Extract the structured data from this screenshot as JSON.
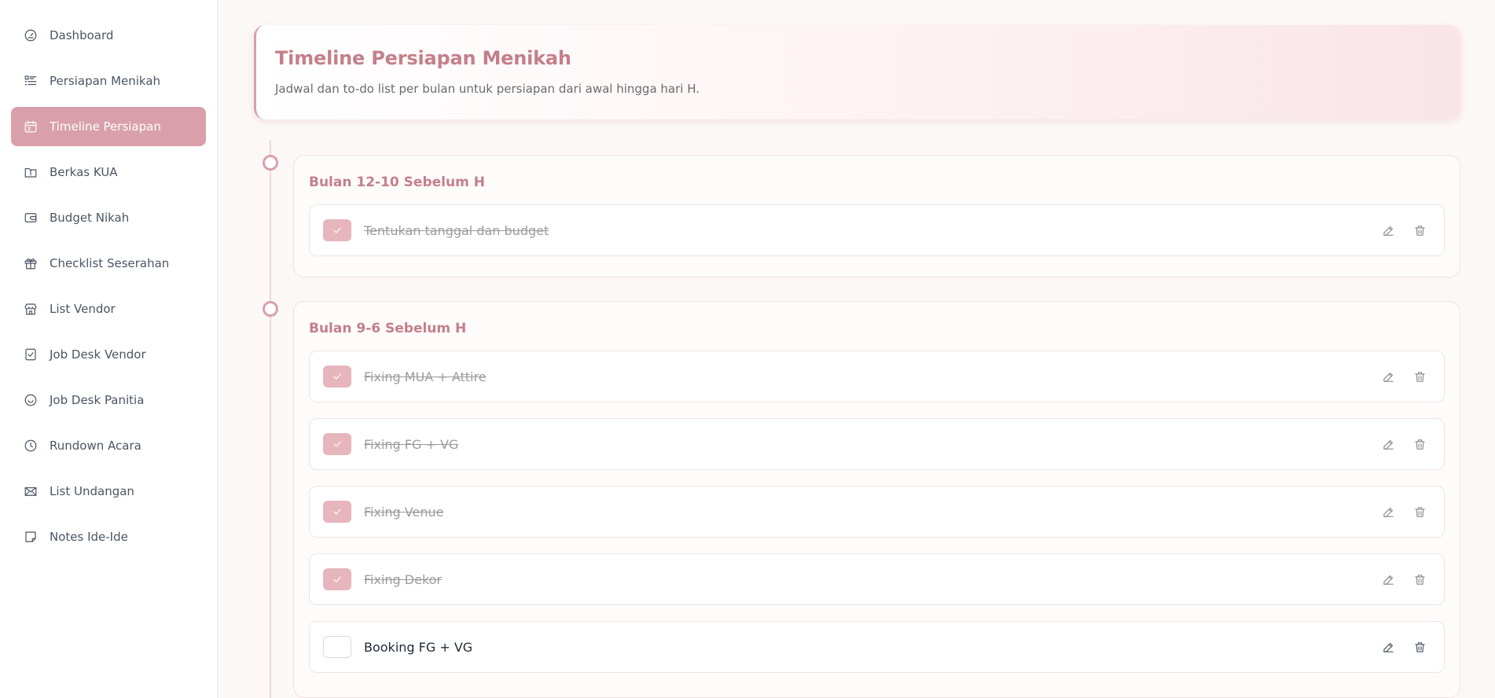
{
  "sidebar": {
    "items": [
      {
        "label": "Dashboard",
        "icon": "gauge-icon"
      },
      {
        "label": "Persiapan Menikah",
        "icon": "list-icon"
      },
      {
        "label": "Timeline Persiapan",
        "icon": "calendar-icon",
        "active": true
      },
      {
        "label": "Berkas KUA",
        "icon": "folder-icon"
      },
      {
        "label": "Budget Nikah",
        "icon": "wallet-icon"
      },
      {
        "label": "Checklist Seserahan",
        "icon": "gift-icon"
      },
      {
        "label": "List Vendor",
        "icon": "store-icon"
      },
      {
        "label": "Job Desk Vendor",
        "icon": "checkbox-icon"
      },
      {
        "label": "Job Desk Panitia",
        "icon": "smile-icon"
      },
      {
        "label": "Rundown Acara",
        "icon": "clock-icon"
      },
      {
        "label": "List Undangan",
        "icon": "mail-icon"
      },
      {
        "label": "Notes Ide-Ide",
        "icon": "note-icon"
      }
    ]
  },
  "header": {
    "title": "Timeline Persiapan Menikah",
    "subtitle": "Jadwal dan to-do list per bulan untuk persiapan dari awal hingga hari H."
  },
  "timeline": {
    "sections": [
      {
        "title": "Bulan 12-10 Sebelum H",
        "tasks": [
          {
            "label": "Tentukan tanggal dan budget",
            "done": true
          }
        ]
      },
      {
        "title": "Bulan 9-6 Sebelum H",
        "tasks": [
          {
            "label": "Fixing MUA + Attire",
            "done": true
          },
          {
            "label": "Fixing FG + VG",
            "done": true
          },
          {
            "label": "Fixing Venue",
            "done": true
          },
          {
            "label": "Fixing Dekor",
            "done": true
          },
          {
            "label": "Booking FG + VG",
            "done": false
          }
        ]
      }
    ]
  },
  "colors": {
    "accent": "#d9a0ab",
    "title": "#c47f8a",
    "checked": "#e7b5bd"
  }
}
